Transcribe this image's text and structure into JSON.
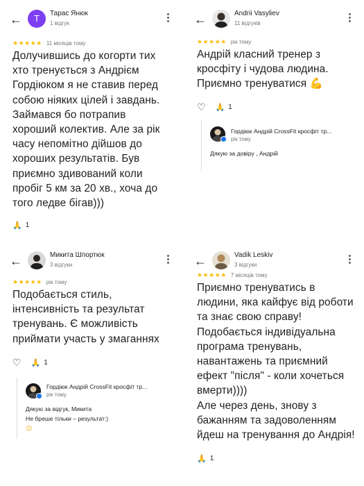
{
  "reviews": [
    {
      "avatar_letter": "T",
      "name": "Тарас Янюк",
      "count": "1 відгук",
      "stars": "★★★★★",
      "time": "11 місяців тому",
      "text": "Долучившись до когорти тих\nхто тренується з Андрієм\nГордіюком я не ставив перед\nсобою ніяких цілей і завдань.\nЗаймався бо потрапив\nхороший колектив. Але за рік\nчасу непомітно дійшов до\nхороших результатів. Був\nприємно здивований коли\nпробіг 5 км за 20 хв., хоча до\nтого ледве бігав)))",
      "reaction_count": "1"
    },
    {
      "name": "Andrii Vasyliev",
      "count": "11 відгуків",
      "stars": "★★★★★",
      "time": "рік тому",
      "text": "Андрій класний тренер з\nкросфіту і чудова людина.\nПриємно тренуватися 💪",
      "reaction_count": "1",
      "owner": {
        "name": "Гордіюк Андрій CrossFit кросфіт тр...",
        "time": "рік тому",
        "text": "Дякую за довіру , Андрій"
      }
    },
    {
      "name": "Микита Шпортюк",
      "count": "3 відгуки",
      "stars": "★★★★★",
      "time": "рік тому",
      "text": "Подобається стиль,\nінтенсивність та результат\nтренувань. Є можливість\nприймати участь у змаганнях",
      "reaction_count": "1",
      "owner": {
        "name": "Гордіюк Андрій CrossFit кросфіт тр...",
        "time": "рік тому",
        "text": "Дякую за відгук, Микита\nНе бреше тільки – результат:)"
      }
    },
    {
      "name": "Vadik Leskiv",
      "count": "3 відгуки",
      "stars": "★★★★★",
      "time": "7 місяців тому",
      "text": "Приємно тренуватись в\nлюдини, яка кайфує від роботи\nта знає свою справу!\nПодобається індивідуальна\nпрограма тренувань,\nнавантажень та приємний\nефект \"після\" - коли хочеться\nвмерти))))\nАле через день, знову з\nбажанням та задоволенням\nйдеш на тренування до Андрія!",
      "reaction_count": "1"
    }
  ],
  "icons": {
    "back": "arrow-left-icon",
    "more": "more-vert-icon",
    "reaction": "pray-icon",
    "heart": "heart-outline-icon"
  },
  "colors": {
    "star": "#fbbc04",
    "meta": "#70757a",
    "letter_avatar": "#7e3ff2",
    "verified": "#1a73e8"
  }
}
